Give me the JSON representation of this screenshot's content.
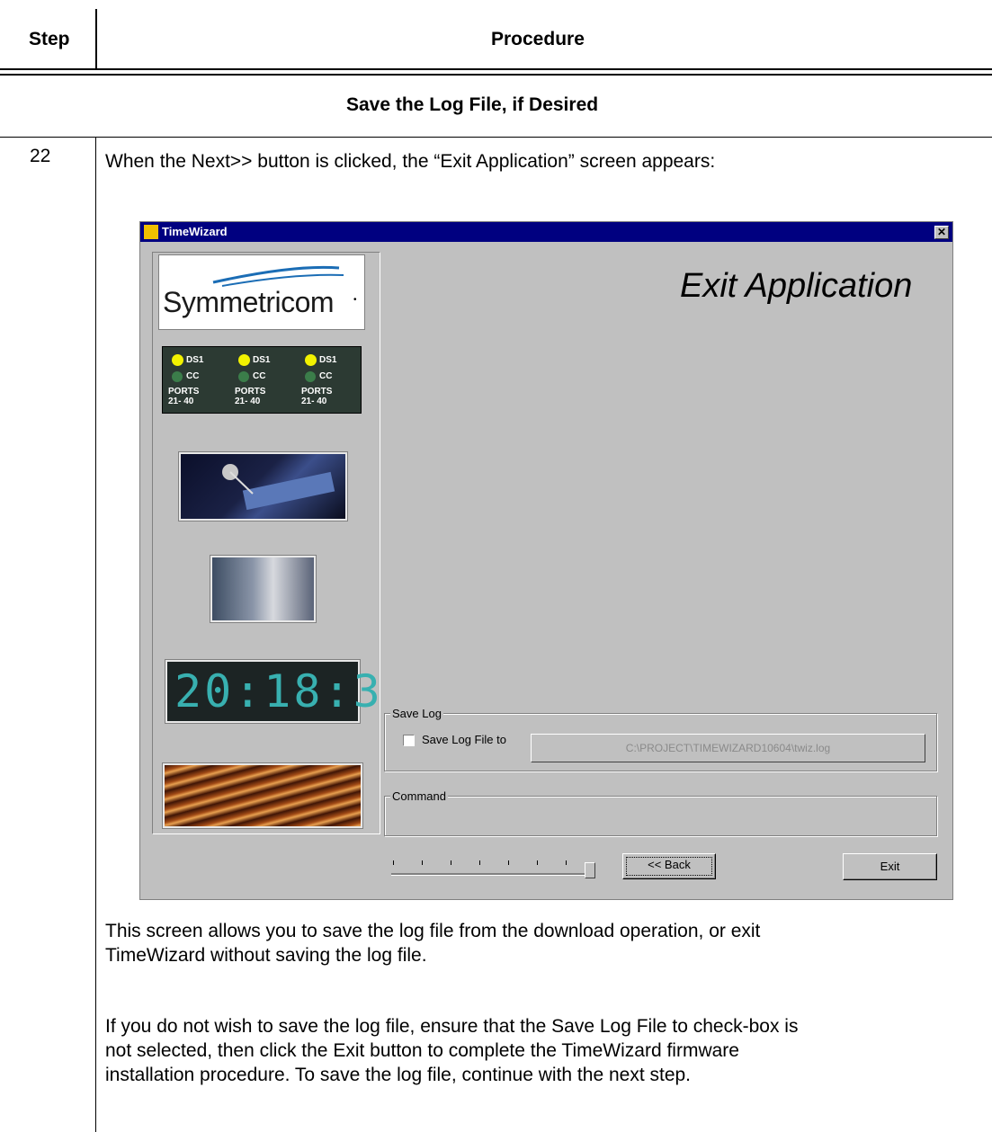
{
  "table": {
    "col_step": "Step",
    "col_procedure": "Procedure",
    "section_heading": "Save the Log File, if Desired",
    "step_number": "22",
    "intro_text": "When the Next>> button is clicked, the “Exit Application” screen appears:",
    "para1_line1": "This screen allows you to save the log file from the download operation, or exit",
    "para1_line2": "TimeWizard without saving the log file.",
    "para2_line1": "If you do not wish to save the log file, ensure that the Save Log File to check-box is",
    "para2_line2": "not selected, then click the Exit button to complete the TimeWizard firmware",
    "para2_line3": "installation procedure. To save the log file, continue with the next step."
  },
  "window": {
    "title": "TimeWizard",
    "close_glyph": "✕",
    "page_heading": "Exit Application",
    "logo": "Symmetricom",
    "logo_mark": "•",
    "clock_display": "20:18:3",
    "ports": [
      {
        "led1": "DS1",
        "led2": "CC",
        "ports_label": "PORTS",
        "range": "21- 40"
      },
      {
        "led1": "DS1",
        "led2": "CC",
        "ports_label": "PORTS",
        "range": "21- 40"
      },
      {
        "led1": "DS1",
        "led2": "CC",
        "ports_label": "PORTS",
        "range": "21- 40"
      }
    ],
    "save_log": {
      "group_label": "Save Log",
      "checkbox_label": "Save Log File to",
      "checked": false,
      "path": "C:\\PROJECT\\TIMEWIZARD10604\\twiz.log"
    },
    "command": {
      "group_label": "Command",
      "value": ""
    },
    "back_button": "<< Back",
    "exit_button": "Exit",
    "progress_fraction": 1.0
  },
  "colors": {
    "titlebar": "#000080",
    "window_bg": "#c0c0c0",
    "led_on": "#f2f200",
    "led_off": "#3b7d4a",
    "clock_digits": "#38b0b0"
  }
}
